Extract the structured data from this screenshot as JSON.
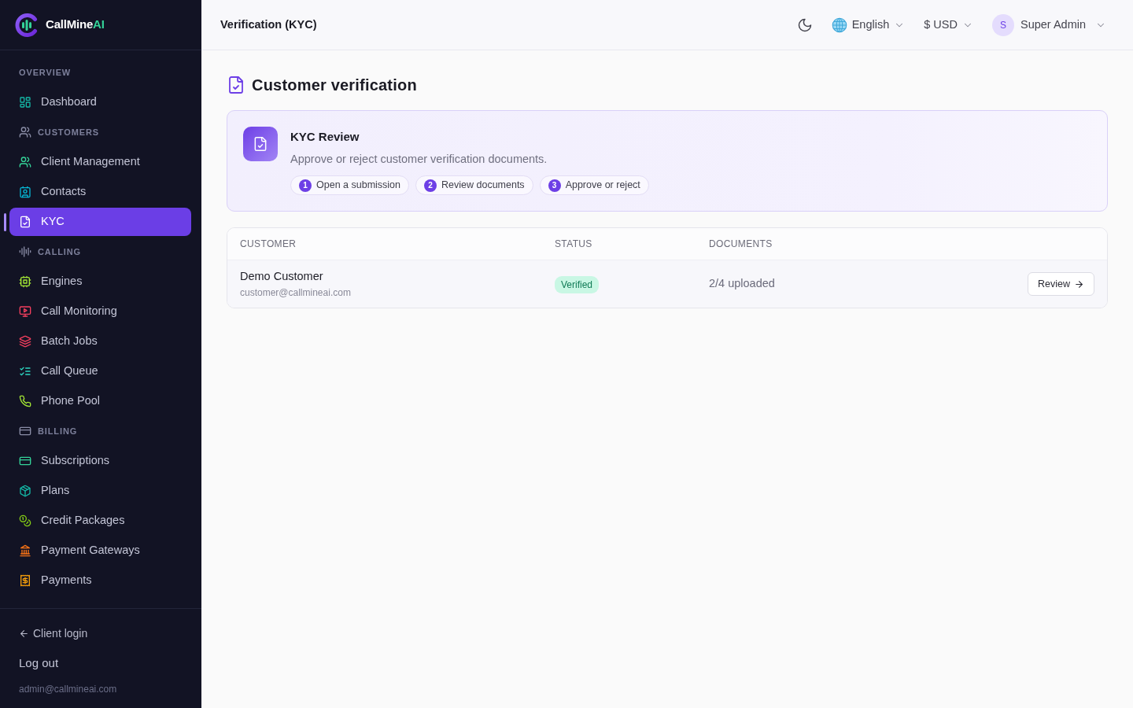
{
  "sidebar": {
    "brand": {
      "name": "CallMine",
      "accent": "AI"
    },
    "nav": [
      {
        "kind": "section",
        "label": "OVERVIEW"
      },
      {
        "kind": "link",
        "label": "Dashboard",
        "selected": false
      },
      {
        "kind": "section",
        "label": "CUSTOMERS"
      },
      {
        "kind": "link",
        "label": "Client Management",
        "selected": false
      },
      {
        "kind": "link",
        "label": "Contacts",
        "selected": false
      },
      {
        "kind": "link",
        "label": "KYC",
        "selected": true
      },
      {
        "kind": "section",
        "label": "CALLING"
      },
      {
        "kind": "link",
        "label": "Engines",
        "selected": false
      },
      {
        "kind": "link",
        "label": "Call Monitoring",
        "selected": false
      },
      {
        "kind": "link",
        "label": "Batch Jobs",
        "selected": false
      },
      {
        "kind": "link",
        "label": "Call Queue",
        "selected": false
      },
      {
        "kind": "link",
        "label": "Phone Pool",
        "selected": false
      },
      {
        "kind": "section",
        "label": "BILLING"
      },
      {
        "kind": "link",
        "label": "Subscriptions",
        "selected": false
      },
      {
        "kind": "link",
        "label": "Plans",
        "selected": false
      },
      {
        "kind": "link",
        "label": "Credit Packages",
        "selected": false
      },
      {
        "kind": "link",
        "label": "Payment Gateways",
        "selected": false
      },
      {
        "kind": "link",
        "label": "Payments",
        "selected": false
      }
    ],
    "footer": {
      "client_login": "Client login",
      "logout": "Log out",
      "email": "admin@callmineai.com"
    }
  },
  "topbar": {
    "title": "Verification (KYC)",
    "language": "English",
    "currency": "$ USD",
    "user": {
      "initial": "S",
      "name": "Super Admin"
    }
  },
  "page": {
    "heading": "Customer verification",
    "banner": {
      "title": "KYC Review",
      "description": "Approve or reject customer verification documents.",
      "steps": [
        {
          "number": "1",
          "label": "Open a submission"
        },
        {
          "number": "2",
          "label": "Review documents"
        },
        {
          "number": "3",
          "label": "Approve or reject"
        }
      ]
    },
    "table": {
      "columns": [
        "CUSTOMER",
        "STATUS",
        "DOCUMENTS"
      ],
      "rows": [
        {
          "name": "Demo Customer",
          "email": "customer@callmineai.com",
          "status": "Verified",
          "documents": "2/4 uploaded",
          "action": "Review"
        }
      ]
    }
  }
}
